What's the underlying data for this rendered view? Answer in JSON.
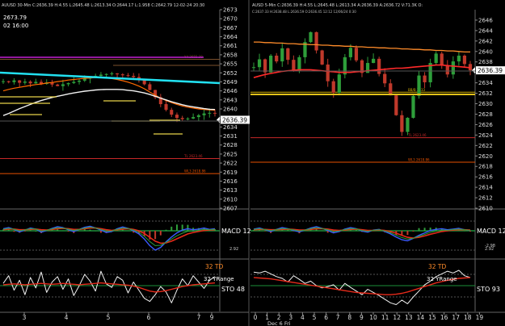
{
  "left_panel": {
    "header": "AUUSD 30-Min C:2636.39 H:4.55 L:2645.48 L:2613.34 O:2644.17 L:1.958 C:2642.79 12-02-24 20:30",
    "price_box": "2673.79",
    "date_box": "02 16:00"
  },
  "right_panel": {
    "header": "AUSD 5-Min C:2636.39 H:4.55 L:2645.48 L:2613.34 A:2636.39 A:2636.72 V:71.3K O:",
    "subheader": "C:2637.33 H:2638.48 L:2636.59 O:2636.45 12:12 12/06/24 0:30"
  },
  "chart_data": [
    {
      "type": "line",
      "panel": "left-price",
      "ylim": [
        2607,
        2673
      ],
      "y_ticks": [
        2673,
        2670,
        2667,
        2664,
        2661,
        2658,
        2655,
        2652,
        2649,
        2646,
        2643,
        2640,
        2637,
        2634,
        2631,
        2628,
        2625,
        2622,
        2619,
        2616,
        2613,
        2610,
        2607
      ],
      "x_ticks": [
        "3",
        "4",
        "5",
        "6",
        "7",
        "9"
      ],
      "current_price": "2636.39",
      "levels": [
        {
          "label": "Y4 2655.38",
          "value": 2656.5,
          "color": "#7b4f2c"
        },
        {
          "label": "TL 2623.46",
          "value": 2623.5,
          "color": "#c62828"
        },
        {
          "label": "WL3 2618.86",
          "value": 2618.5,
          "color": "#e65100"
        }
      ],
      "series": [
        {
          "values": [
            2649.2,
            2648.9,
            2649.5,
            2648.7,
            2649.1,
            2648.5,
            2649.0,
            2648.3,
            2648.8,
            2648.1,
            2647.6,
            2648.2,
            2648.6,
            2649.0,
            2649.4,
            2650.1,
            2650.6,
            2651.0,
            2651.4,
            2651.6,
            2651.8,
            2651.5,
            2651.2,
            2651.0,
            2650.6,
            2649.8,
            2648.2,
            2646.3,
            2643.9,
            2641.6,
            2639.7,
            2638.1,
            2637.0,
            2636.6,
            2636.8,
            2637.3,
            2637.9,
            2638.5,
            2638.7,
            2638.5
          ]
        },
        {
          "values": [
            2646.0,
            2646.5,
            2646.9,
            2647.2,
            2647.5,
            2647.8,
            2648.1,
            2648.3,
            2648.6,
            2648.8,
            2649.1,
            2649.3,
            2649.6,
            2649.8,
            2650.0,
            2650.2,
            2650.3,
            2650.4,
            2650.4,
            2650.3,
            2650.1,
            2649.8,
            2649.4,
            2648.9,
            2648.3,
            2647.6,
            2646.7,
            2645.6,
            2644.6,
            2643.6,
            2642.8,
            2642.1,
            2641.5,
            2641.0,
            2640.6,
            2640.3,
            2640.0,
            2639.8,
            2639.7,
            2639.6
          ]
        },
        {
          "values": [
            2637.8,
            2638.5,
            2639.3,
            2640.1,
            2640.8,
            2641.5,
            2642.2,
            2642.8,
            2643.3,
            2643.8,
            2644.2,
            2644.6,
            2645.0,
            2645.3,
            2645.6,
            2645.9,
            2646.1,
            2646.3,
            2646.4,
            2646.5,
            2646.5,
            2646.5,
            2646.4,
            2646.2,
            2646.0,
            2645.7,
            2645.3,
            2644.8,
            2644.2,
            2643.6,
            2643.0,
            2642.4,
            2641.9,
            2641.4,
            2641.0,
            2640.7,
            2640.4,
            2640.1,
            2639.9,
            2639.8
          ]
        }
      ]
    },
    {
      "type": "line",
      "panel": "right-price",
      "ylim": [
        2610,
        2648
      ],
      "y_ticks": [
        2646,
        2644,
        2642,
        2640,
        2638,
        2636,
        2634,
        2632,
        2630,
        2628,
        2626,
        2624,
        2622,
        2620,
        2618,
        2616,
        2614,
        2612,
        2610
      ],
      "x_ticks": [
        "0",
        "1",
        "2",
        "3",
        "4",
        "5",
        "6",
        "7",
        "8",
        "9",
        "10",
        "11",
        "12",
        "13",
        "14",
        "15",
        "16",
        "17",
        "18",
        "19"
      ],
      "x_caption": "Dec 6 Fri",
      "current_price": "2636.39",
      "levels": [
        {
          "label": "BB/B 2633",
          "value": 2632.2,
          "color": "#d4b106"
        },
        {
          "label": "TL 2623.46",
          "value": 2623.5,
          "color": "#c62828"
        },
        {
          "label": "WL3 2618.86",
          "value": 2618.8,
          "color": "#e65100"
        }
      ],
      "series": [
        {
          "values": [
            2637.0,
            2638.5,
            2636.0,
            2639.2,
            2638.1,
            2640.6,
            2638.4,
            2636.2,
            2638.9,
            2641.8,
            2643.7,
            2640.2,
            2637.5,
            2634.3,
            2632.1,
            2635.6,
            2638.9,
            2640.7,
            2638.3,
            2635.9,
            2637.8,
            2638.6,
            2635.7,
            2633.9,
            2631.6,
            2627.8,
            2624.6,
            2627.3,
            2631.5,
            2635.4,
            2634.1,
            2637.8,
            2639.6,
            2637.3,
            2635.6,
            2638.1,
            2639.2,
            2637.6,
            2636.4
          ]
        },
        {
          "values": [
            2641.8,
            2641.8,
            2641.7,
            2641.7,
            2641.6,
            2641.6,
            2641.5,
            2641.5,
            2641.4,
            2641.4,
            2641.3,
            2641.3,
            2641.2,
            2641.2,
            2641.1,
            2641.1,
            2641.0,
            2641.0,
            2640.9,
            2640.9,
            2640.8,
            2640.8,
            2640.7,
            2640.7,
            2640.6,
            2640.6,
            2640.5,
            2640.5,
            2640.4,
            2640.4,
            2640.3,
            2640.3,
            2640.2,
            2640.2,
            2640.1,
            2640.1,
            2640.0,
            2639.9,
            2639.9
          ]
        },
        {
          "values": [
            2635.0,
            2635.3,
            2635.6,
            2635.8,
            2636.0,
            2636.2,
            2636.3,
            2636.4,
            2636.5,
            2636.5,
            2636.5,
            2636.4,
            2636.3,
            2636.2,
            2636.1,
            2636.0,
            2636.0,
            2636.0,
            2636.1,
            2636.2,
            2636.3,
            2636.4,
            2636.5,
            2636.6,
            2636.7,
            2636.8,
            2636.8,
            2636.9,
            2637.0,
            2637.1,
            2637.2,
            2637.3,
            2637.4,
            2637.4,
            2637.3,
            2637.2,
            2637.1,
            2637.0,
            2636.9
          ]
        }
      ]
    },
    {
      "type": "line",
      "panel": "left-macd",
      "label": "MACD 12",
      "y_ticks": [
        "2.92"
      ],
      "series": [
        {
          "values": [
            0.6,
            0.9,
            0.4,
            -0.3,
            0.2,
            0.8,
            0.5,
            -0.4,
            0.1,
            0.7,
            1.2,
            0.9,
            0.3,
            -0.2,
            0.4,
            1.0,
            1.3,
            0.8,
            0.2,
            -0.5,
            -0.2,
            0.6,
            1.1,
            0.7,
            0.0,
            -0.9,
            -2.4,
            -4.3,
            -5.6,
            -4.8,
            -3.2,
            -1.8,
            -0.6,
            0.2,
            0.6,
            0.3,
            0.5,
            0.8,
            0.4,
            0.6
          ]
        },
        {
          "values": [
            0.3,
            0.5,
            0.5,
            0.3,
            0.3,
            0.4,
            0.5,
            0.3,
            0.2,
            0.4,
            0.6,
            0.7,
            0.6,
            0.4,
            0.4,
            0.6,
            0.8,
            0.8,
            0.6,
            0.3,
            0.1,
            0.3,
            0.5,
            0.6,
            0.4,
            0.0,
            -0.8,
            -1.9,
            -3.0,
            -3.6,
            -3.5,
            -3.0,
            -2.3,
            -1.6,
            -0.9,
            -0.5,
            -0.2,
            0.1,
            0.2,
            0.3
          ]
        }
      ]
    },
    {
      "type": "line",
      "panel": "right-macd",
      "label": "MACD 12",
      "y_ticks": [
        "2.92",
        "-2.98"
      ],
      "series": [
        {
          "values": [
            0.5,
            0.8,
            0.3,
            -0.2,
            0.4,
            0.9,
            0.6,
            0.1,
            -0.3,
            0.2,
            0.8,
            1.2,
            0.7,
            0.1,
            -0.6,
            -0.2,
            0.5,
            0.9,
            0.6,
            -0.1,
            -0.4,
            0.2,
            0.4,
            -0.2,
            -0.9,
            -1.8,
            -2.6,
            -2.9,
            -2.2,
            -1.3,
            -0.6,
            0.1,
            0.4,
            0.6,
            0.3,
            0.5,
            0.7,
            0.3,
            0.1
          ]
        },
        {
          "values": [
            0.3,
            0.4,
            0.4,
            0.3,
            0.3,
            0.4,
            0.5,
            0.4,
            0.2,
            0.2,
            0.4,
            0.6,
            0.6,
            0.5,
            0.2,
            0.1,
            0.2,
            0.4,
            0.5,
            0.3,
            0.1,
            0.1,
            0.2,
            0.1,
            -0.2,
            -0.7,
            -1.3,
            -1.9,
            -2.1,
            -1.9,
            -1.5,
            -1.0,
            -0.6,
            -0.2,
            0.0,
            0.2,
            0.3,
            0.3,
            0.2
          ]
        }
      ]
    },
    {
      "type": "line",
      "panel": "left-stochastic",
      "labels": {
        "td": "32 TD",
        "range": "32 YRange",
        "sto": "STO  48"
      },
      "series": [
        {
          "values": [
            55,
            72,
            40,
            62,
            30,
            68,
            45,
            80,
            35,
            58,
            70,
            42,
            65,
            28,
            50,
            75,
            60,
            38,
            82,
            54,
            46,
            70,
            62,
            34,
            58,
            40,
            22,
            15,
            30,
            48,
            36,
            12,
            40,
            65,
            50,
            72,
            58,
            44,
            62,
            70
          ]
        },
        {
          "values": [
            52,
            53,
            54,
            53,
            52,
            53,
            54,
            55,
            54,
            53,
            54,
            55,
            54,
            53,
            52,
            53,
            54,
            55,
            56,
            55,
            54,
            53,
            52,
            51,
            49,
            46,
            42,
            38,
            36,
            37,
            39,
            42,
            45,
            48,
            50,
            52,
            53,
            54,
            55,
            56
          ]
        }
      ]
    },
    {
      "type": "line",
      "panel": "right-stochastic",
      "labels": {
        "td": "32 TD",
        "range": "32 YRange",
        "sto": "STO  93"
      },
      "series": [
        {
          "values": [
            80,
            78,
            82,
            76,
            70,
            66,
            58,
            72,
            64,
            55,
            60,
            50,
            45,
            48,
            52,
            40,
            55,
            46,
            38,
            30,
            42,
            35,
            28,
            20,
            12,
            8,
            18,
            10,
            25,
            38,
            52,
            60,
            70,
            76,
            82,
            78,
            84,
            72,
            68
          ]
        },
        {
          "values": [
            68,
            67,
            66,
            65,
            63,
            61,
            59,
            57,
            55,
            53,
            51,
            49,
            47,
            45,
            43,
            41,
            39,
            37,
            35,
            34,
            33,
            32,
            31,
            30,
            30,
            31,
            33,
            36,
            40,
            44,
            48,
            52,
            56,
            59,
            62,
            64,
            66,
            67,
            68
          ]
        }
      ]
    }
  ]
}
